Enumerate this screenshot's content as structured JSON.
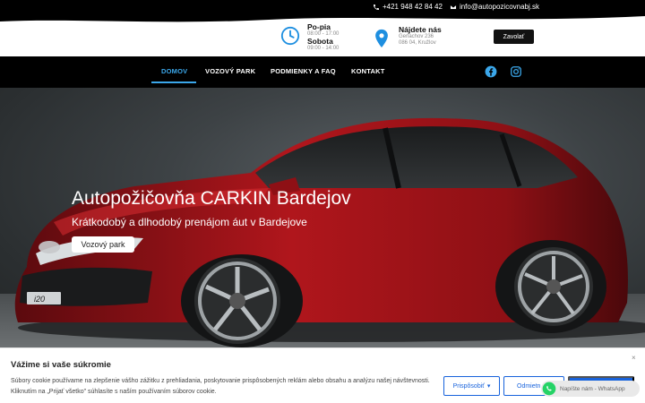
{
  "topbar": {
    "phone": "+421 948 42 84 42",
    "email": "info@autopozicovnabj.sk"
  },
  "header": {
    "hours": {
      "line1_title": "Po-pia",
      "line1_time": "08:00 - 17:00",
      "line2_title": "Sobota",
      "line2_time": "09:00 - 14:00",
      "icon": "clock-icon"
    },
    "location": {
      "title": "Nájdete nás",
      "street": "Gerlachov 236",
      "city": "086 04, Kružlov",
      "icon": "map-pin-icon"
    },
    "call_label": "Zavolať"
  },
  "nav": {
    "items": [
      {
        "label": "DOMOV",
        "active": true
      },
      {
        "label": "VOZOVÝ PARK",
        "active": false
      },
      {
        "label": "PODMIENKY A FAQ",
        "active": false
      },
      {
        "label": "KONTAKT",
        "active": false
      }
    ],
    "social": [
      "facebook-icon",
      "instagram-icon"
    ]
  },
  "hero": {
    "title": "Autopožičovňa CARKIN Bardejov",
    "subtitle": "Krátkodobý a dlhodobý prenájom áut v Bardejove",
    "button_label": "Vozový park",
    "plate": "i20"
  },
  "cookie": {
    "title": "Vážime si vaše súkromie",
    "text": "Súbory cookie používame na zlepšenie vášho zážitku z prehliadania, poskytovanie prispôsobených reklám alebo obsahu a analýzu našej návštevnosti. Kliknutím na „Prijať všetko\" súhlasíte s naším používaním súborov cookie.",
    "customize_label": "Prispôsobiť",
    "reject_label": "Odmietn",
    "close_label": "×"
  },
  "whatsapp": {
    "label": "Napíšte nám - WhatsApp"
  },
  "colors": {
    "accent": "#3ba7ea",
    "cookie_blue": "#1863dc",
    "car_red": "#b0161c",
    "whatsapp_green": "#25d366"
  }
}
